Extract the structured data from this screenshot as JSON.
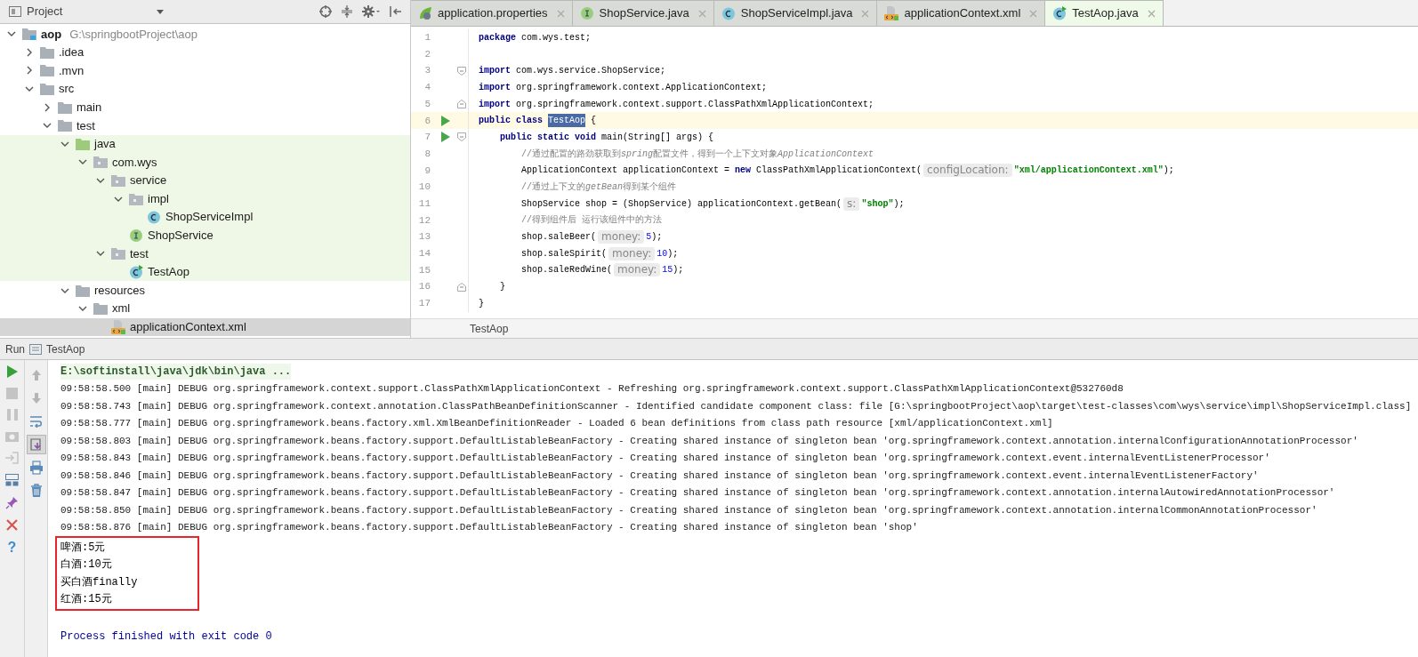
{
  "project_panel": {
    "title": "Project",
    "tree": [
      {
        "name": "aop",
        "path": "G:\\springbootProject\\aop",
        "kind": "module",
        "expanded": true,
        "selected": false,
        "children": [
          {
            "name": ".idea",
            "kind": "folder",
            "expanded": false,
            "selected": false
          },
          {
            "name": ".mvn",
            "kind": "folder",
            "expanded": false,
            "selected": false
          },
          {
            "name": "src",
            "kind": "folder",
            "expanded": true,
            "selected": false,
            "children": [
              {
                "name": "main",
                "kind": "folder",
                "expanded": false,
                "selected": false
              },
              {
                "name": "test",
                "kind": "folder",
                "expanded": true,
                "selected": false,
                "children": [
                  {
                    "name": "java",
                    "kind": "test_root",
                    "expanded": true,
                    "selected": false,
                    "test_scope": true,
                    "children": [
                      {
                        "name": "com.wys",
                        "kind": "package",
                        "expanded": true,
                        "selected": false,
                        "test_scope": true,
                        "children": [
                          {
                            "name": "service",
                            "kind": "package",
                            "expanded": true,
                            "selected": false,
                            "test_scope": true,
                            "children": [
                              {
                                "name": "impl",
                                "kind": "package",
                                "expanded": true,
                                "selected": false,
                                "test_scope": true,
                                "children": [
                                  {
                                    "name": "ShopServiceImpl",
                                    "kind": "class",
                                    "selected": false,
                                    "test_scope": true
                                  }
                                ]
                              },
                              {
                                "name": "ShopService",
                                "kind": "interface",
                                "selected": false,
                                "test_scope": true
                              }
                            ]
                          },
                          {
                            "name": "test",
                            "kind": "package",
                            "expanded": true,
                            "selected": false,
                            "test_scope": true,
                            "children": [
                              {
                                "name": "TestAop",
                                "kind": "runnable_class",
                                "selected": false,
                                "test_scope": true
                              }
                            ]
                          }
                        ]
                      }
                    ]
                  },
                  {
                    "name": "resources",
                    "kind": "folder",
                    "expanded": true,
                    "selected": false,
                    "children": [
                      {
                        "name": "xml",
                        "kind": "folder",
                        "expanded": true,
                        "selected": false,
                        "children": [
                          {
                            "name": "applicationContext.xml",
                            "kind": "xml",
                            "selected": true
                          }
                        ]
                      }
                    ]
                  }
                ]
              }
            ]
          }
        ]
      }
    ]
  },
  "editor": {
    "tabs": [
      {
        "label": "application.properties",
        "kind": "spring",
        "selected": false
      },
      {
        "label": "ShopService.java",
        "kind": "interface",
        "selected": false
      },
      {
        "label": "ShopServiceImpl.java",
        "kind": "class",
        "selected": false
      },
      {
        "label": "applicationContext.xml",
        "kind": "xml",
        "selected": false
      },
      {
        "label": "TestAop.java",
        "kind": "runnable_class",
        "selected": true
      }
    ],
    "lines": [
      {
        "number": "1",
        "kind": "plain",
        "run": false,
        "current": false,
        "tokens": [
          {
            "kind": "kw",
            "text": "package"
          },
          {
            "kind": "plain",
            "text": " com.wys.test;"
          }
        ]
      },
      {
        "number": "2",
        "kind": "plain",
        "run": false,
        "current": false
      },
      {
        "number": "3",
        "kind": "fold_start",
        "run": false,
        "current": false,
        "tokens": [
          {
            "kind": "kw",
            "text": "import"
          },
          {
            "kind": "plain",
            "text": " com.wys.service.ShopService;"
          }
        ]
      },
      {
        "number": "4",
        "kind": "plain",
        "run": false,
        "current": false,
        "tokens": [
          {
            "kind": "kw",
            "text": "import"
          },
          {
            "kind": "plain",
            "text": " org.springframework.context.ApplicationContext;"
          }
        ]
      },
      {
        "number": "5",
        "kind": "fold_end",
        "run": false,
        "current": false,
        "tokens": [
          {
            "kind": "kw",
            "text": "import"
          },
          {
            "kind": "plain",
            "text": " org.springframework.context.support.ClassPathXmlApplicationContext;"
          }
        ]
      },
      {
        "number": "6",
        "kind": "plain",
        "run": true,
        "current": true,
        "tokens": [
          {
            "kind": "kw",
            "text": "public class "
          },
          {
            "kind": "selection",
            "text": "TestAop"
          },
          {
            "kind": "plain",
            "text": " {"
          }
        ]
      },
      {
        "number": "7",
        "kind": "fold_start",
        "run": true,
        "current": false,
        "tokens": [
          {
            "kind": "kw",
            "text": "    public static void"
          },
          {
            "kind": "plain",
            "text": " main(String[] args) {"
          }
        ]
      },
      {
        "number": "8",
        "kind": "plain",
        "run": false,
        "current": false,
        "tokens": [
          {
            "kind": "comment",
            "text": "        //通过配置的路劲获取到"
          },
          {
            "kind": "comment_italic",
            "text": "spring"
          },
          {
            "kind": "comment",
            "text": "配置文件，得到一个上下文对象"
          },
          {
            "kind": "comment_italic",
            "text": "ApplicationContext"
          }
        ]
      },
      {
        "number": "9",
        "kind": "plain",
        "run": false,
        "current": false,
        "tokens": [
          {
            "kind": "plain",
            "text": "        ApplicationContext applicationContext = "
          },
          {
            "kind": "kw",
            "text": "new"
          },
          {
            "kind": "plain",
            "text": " ClassPathXmlApplicationContext("
          },
          {
            "kind": "hint",
            "text": "configLocation:"
          },
          {
            "kind": "str",
            "text": "\"xml/applicationContext.xml\""
          },
          {
            "kind": "plain",
            "text": ");"
          }
        ]
      },
      {
        "number": "10",
        "kind": "plain",
        "run": false,
        "current": false,
        "tokens": [
          {
            "kind": "comment",
            "text": "        //通过上下文的"
          },
          {
            "kind": "comment_italic",
            "text": "getBean"
          },
          {
            "kind": "comment",
            "text": "得到某个组件"
          }
        ]
      },
      {
        "number": "11",
        "kind": "plain",
        "run": false,
        "current": false,
        "tokens": [
          {
            "kind": "plain",
            "text": "        ShopService shop = (ShopService) applicationContext.getBean("
          },
          {
            "kind": "hint",
            "text": "s:"
          },
          {
            "kind": "str",
            "text": "\"shop\""
          },
          {
            "kind": "plain",
            "text": ");"
          }
        ]
      },
      {
        "number": "12",
        "kind": "plain",
        "run": false,
        "current": false,
        "tokens": [
          {
            "kind": "comment",
            "text": "        //得到组件后 运行该组件中的方法"
          }
        ]
      },
      {
        "number": "13",
        "kind": "plain",
        "run": false,
        "current": false,
        "tokens": [
          {
            "kind": "plain",
            "text": "        shop.saleBeer("
          },
          {
            "kind": "hint",
            "text": "money:"
          },
          {
            "kind": "num",
            "text": "5"
          },
          {
            "kind": "plain",
            "text": ");"
          }
        ]
      },
      {
        "number": "14",
        "kind": "plain",
        "run": false,
        "current": false,
        "tokens": [
          {
            "kind": "plain",
            "text": "        shop.saleSpirit("
          },
          {
            "kind": "hint",
            "text": "money:"
          },
          {
            "kind": "num",
            "text": "10"
          },
          {
            "kind": "plain",
            "text": ");"
          }
        ]
      },
      {
        "number": "15",
        "kind": "plain",
        "run": false,
        "current": false,
        "tokens": [
          {
            "kind": "plain",
            "text": "        shop.saleRedWine("
          },
          {
            "kind": "hint",
            "text": "money:"
          },
          {
            "kind": "num",
            "text": "15"
          },
          {
            "kind": "plain",
            "text": ");"
          }
        ]
      },
      {
        "number": "16",
        "kind": "fold_end",
        "run": false,
        "current": false,
        "tokens": [
          {
            "kind": "plain",
            "text": "    }"
          }
        ]
      },
      {
        "number": "17",
        "kind": "plain",
        "run": false,
        "current": false,
        "tokens": [
          {
            "kind": "plain",
            "text": "}"
          }
        ]
      }
    ],
    "breadcrumb": "TestAop"
  },
  "run_panel": {
    "label": "Run",
    "config": "TestAop",
    "help": "?",
    "toolbar": [
      {
        "kind": "up",
        "pressed": false
      },
      {
        "kind": "down",
        "pressed": false
      },
      {
        "kind": "wrap",
        "pressed": false
      },
      {
        "kind": "scroll_end",
        "pressed": true
      },
      {
        "kind": "print",
        "pressed": false
      },
      {
        "kind": "trash",
        "pressed": false
      }
    ],
    "console": [
      {
        "kind": "command",
        "text": "E:\\softinstall\\java\\jdk\\bin\\java ..."
      },
      {
        "kind": "log",
        "text": "09:58:58.500 [main] DEBUG org.springframework.context.support.ClassPathXmlApplicationContext - Refreshing org.springframework.context.support.ClassPathXmlApplicationContext@532760d8"
      },
      {
        "kind": "log",
        "text": "09:58:58.743 [main] DEBUG org.springframework.context.annotation.ClassPathBeanDefinitionScanner - Identified candidate component class: file [G:\\springbootProject\\aop\\target\\test-classes\\com\\wys\\service\\impl\\ShopServiceImpl.class]"
      },
      {
        "kind": "log",
        "text": "09:58:58.777 [main] DEBUG org.springframework.beans.factory.xml.XmlBeanDefinitionReader - Loaded 6 bean definitions from class path resource [xml/applicationContext.xml]"
      },
      {
        "kind": "log",
        "text": "09:58:58.803 [main] DEBUG org.springframework.beans.factory.support.DefaultListableBeanFactory - Creating shared instance of singleton bean 'org.springframework.context.annotation.internalConfigurationAnnotationProcessor'"
      },
      {
        "kind": "log",
        "text": "09:58:58.843 [main] DEBUG org.springframework.beans.factory.support.DefaultListableBeanFactory - Creating shared instance of singleton bean 'org.springframework.context.event.internalEventListenerProcessor'"
      },
      {
        "kind": "log",
        "text": "09:58:58.846 [main] DEBUG org.springframework.beans.factory.support.DefaultListableBeanFactory - Creating shared instance of singleton bean 'org.springframework.context.event.internalEventListenerFactory'"
      },
      {
        "kind": "log",
        "text": "09:58:58.847 [main] DEBUG org.springframework.beans.factory.support.DefaultListableBeanFactory - Creating shared instance of singleton bean 'org.springframework.context.annotation.internalAutowiredAnnotationProcessor'"
      },
      {
        "kind": "log",
        "text": "09:58:58.850 [main] DEBUG org.springframework.beans.factory.support.DefaultListableBeanFactory - Creating shared instance of singleton bean 'org.springframework.context.annotation.internalCommonAnnotationProcessor'"
      },
      {
        "kind": "log",
        "text": "09:58:58.876 [main] DEBUG org.springframework.beans.factory.support.DefaultListableBeanFactory - Creating shared instance of singleton bean 'shop'"
      }
    ],
    "highlighted_output": [
      "啤酒:5元",
      "白酒:10元",
      "买白酒finally",
      "红酒:15元"
    ],
    "exit": "Process finished with exit code 0"
  }
}
